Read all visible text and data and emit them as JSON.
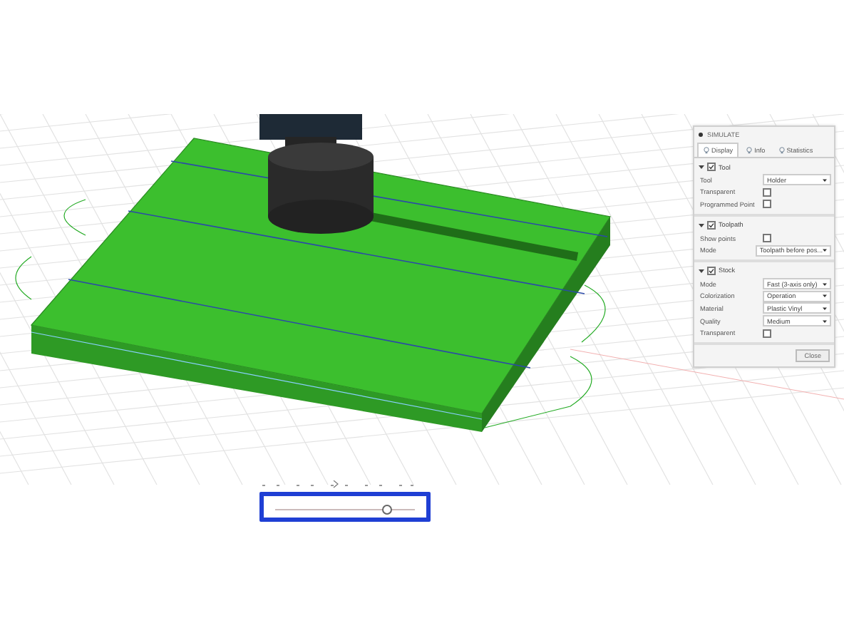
{
  "panel": {
    "title": "SIMULATE",
    "tabs": [
      {
        "label": "Display",
        "selected": true
      },
      {
        "label": "Info",
        "selected": false
      },
      {
        "label": "Statistics",
        "selected": false
      }
    ],
    "sections": [
      {
        "title": "Tool",
        "expanded": true,
        "checked": true,
        "rows": [
          {
            "kind": "dropdown",
            "label": "Tool",
            "value": "Holder"
          },
          {
            "kind": "checkbox",
            "label": "Transparent",
            "checked": false
          },
          {
            "kind": "checkbox",
            "label": "Programmed Point",
            "checked": false
          }
        ]
      },
      {
        "title": "Toolpath",
        "expanded": true,
        "checked": true,
        "rows": [
          {
            "kind": "checkbox",
            "label": "Show points",
            "checked": false
          },
          {
            "kind": "dropdown",
            "label": "Mode",
            "value": "Toolpath before pos..."
          }
        ]
      },
      {
        "title": "Stock",
        "expanded": true,
        "checked": true,
        "rows": [
          {
            "kind": "dropdown",
            "label": "Mode",
            "value": "Fast (3-axis only)"
          },
          {
            "kind": "dropdown",
            "label": "Colorization",
            "value": "Operation"
          },
          {
            "kind": "dropdown",
            "label": "Material",
            "value": "Plastic Vinyl"
          },
          {
            "kind": "dropdown",
            "label": "Quality",
            "value": "Medium"
          },
          {
            "kind": "checkbox",
            "label": "Transparent",
            "checked": false
          }
        ]
      }
    ],
    "close_button": "Close"
  },
  "timeline": {
    "level": 0.8
  }
}
